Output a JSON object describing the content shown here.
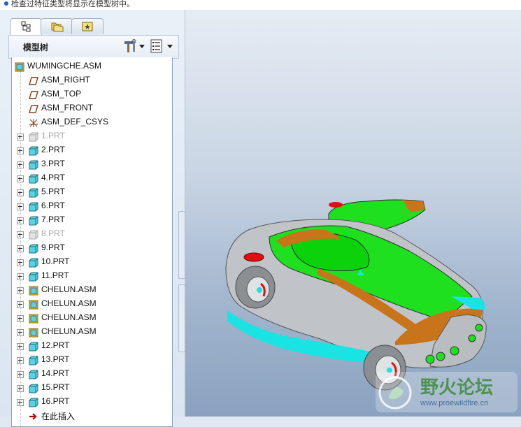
{
  "message_bar": {
    "text": "检查过特征类型将显示在模型树中。"
  },
  "left_panel": {
    "tabs": [
      {
        "name": "model-tree-tab"
      },
      {
        "name": "folder-browser-tab"
      },
      {
        "name": "favorites-tab"
      }
    ],
    "toolbar": {
      "title": "模型树"
    },
    "tree": {
      "root": "WUMINGCHE.ASM",
      "datums": [
        "ASM_RIGHT",
        "ASM_TOP",
        "ASM_FRONT"
      ],
      "csys": "ASM_DEF_CSYS",
      "parts": [
        {
          "label": "1.PRT",
          "suppressed": true
        },
        {
          "label": "2.PRT"
        },
        {
          "label": "3.PRT"
        },
        {
          "label": "4.PRT"
        },
        {
          "label": "5.PRT"
        },
        {
          "label": "6.PRT"
        },
        {
          "label": "7.PRT"
        },
        {
          "label": "8.PRT",
          "suppressed": true
        },
        {
          "label": "9.PRT"
        },
        {
          "label": "10.PRT"
        },
        {
          "label": "11.PRT"
        },
        {
          "label": "CHELUN.ASM",
          "assembly": true
        },
        {
          "label": "CHELUN.ASM",
          "assembly": true
        },
        {
          "label": "CHELUN.ASM",
          "assembly": true
        },
        {
          "label": "CHELUN.ASM",
          "assembly": true
        },
        {
          "label": "12.PRT"
        },
        {
          "label": "13.PRT"
        },
        {
          "label": "14.PRT"
        },
        {
          "label": "15.PRT"
        },
        {
          "label": "16.PRT"
        }
      ],
      "insert_here": "在此插入"
    }
  },
  "watermark": {
    "title": "野火论坛",
    "url": "www.proewildfire.cn"
  },
  "colors": {
    "accent": "#1b5fd0",
    "car_green": "#1ee01e",
    "car_cyan": "#19e3e3",
    "car_orange": "#c8741a",
    "car_silver": "#c0c4c8"
  }
}
